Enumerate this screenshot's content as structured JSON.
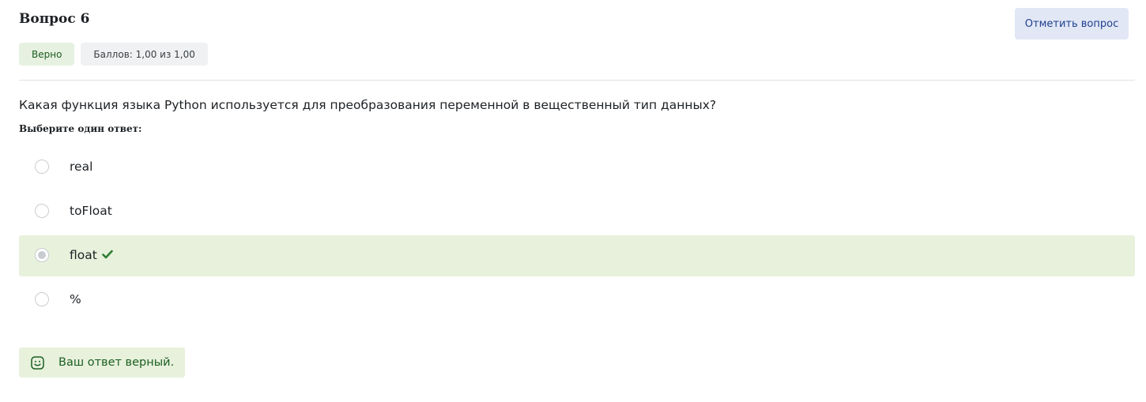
{
  "question": {
    "title": "Вопрос 6",
    "status_badge": "Верно",
    "score_badge": "Баллов: 1,00 из 1,00",
    "flag_button": "Отметить вопрос",
    "text": "Какая функция языка Python используется для преобразования переменной в вещественный тип данных?",
    "prompt": "Выберите один ответ:"
  },
  "answers": [
    {
      "label": "real",
      "selected": false,
      "correct": false
    },
    {
      "label": "toFloat",
      "selected": false,
      "correct": false
    },
    {
      "label": "float",
      "selected": true,
      "correct": true
    },
    {
      "label": "%",
      "selected": false,
      "correct": false
    }
  ],
  "feedback": {
    "text": "Ваш ответ верный.",
    "icon": "smiley-icon"
  },
  "icons": {
    "correct_mark": "check-icon"
  },
  "colors": {
    "correct_background": "#e7f1dc",
    "correct_text": "#1b5e20",
    "flag_button_background": "#e1e7f5",
    "flag_button_text": "#1f3f8f",
    "check_mark": "#2e7d32"
  }
}
